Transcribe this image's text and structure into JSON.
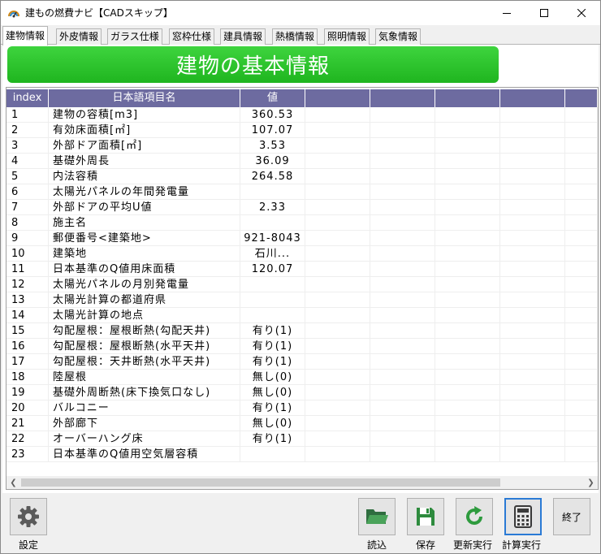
{
  "window": {
    "title": "建もの燃費ナビ【CADスキップ】"
  },
  "tabs": [
    {
      "label": "建物情報",
      "active": true
    },
    {
      "label": "外皮情報"
    },
    {
      "label": "ガラス仕様"
    },
    {
      "label": "窓枠仕様"
    },
    {
      "label": "建具情報"
    },
    {
      "label": "熱橋情報"
    },
    {
      "label": "照明情報"
    },
    {
      "label": "気象情報"
    }
  ],
  "header": {
    "title": "建物の基本情報",
    "color": "#2fc42f"
  },
  "grid": {
    "columns": [
      "index",
      "日本語項目名",
      "値",
      "",
      "",
      "",
      "",
      ""
    ],
    "header_color": "#6d6ba0",
    "rows": [
      {
        "index": "1",
        "name": "建物の容積[m3]",
        "value": "360.53"
      },
      {
        "index": "2",
        "name": "有効床面積[㎡]",
        "value": "107.07"
      },
      {
        "index": "3",
        "name": "外部ドア面積[㎡]",
        "value": "3.53"
      },
      {
        "index": "4",
        "name": "基礎外周長",
        "value": "36.09"
      },
      {
        "index": "5",
        "name": "内法容積",
        "value": "264.58"
      },
      {
        "index": "6",
        "name": "太陽光パネルの年間発電量",
        "value": ""
      },
      {
        "index": "7",
        "name": "外部ドアの平均U値",
        "value": "2.33"
      },
      {
        "index": "8",
        "name": "施主名",
        "value": ""
      },
      {
        "index": "9",
        "name": "郵便番号<建築地>",
        "value": "921-8043"
      },
      {
        "index": "10",
        "name": "建築地",
        "value": "石川..."
      },
      {
        "index": "11",
        "name": "日本基準のQ値用床面積",
        "value": "120.07"
      },
      {
        "index": "12",
        "name": "太陽光パネルの月別発電量",
        "value": ""
      },
      {
        "index": "13",
        "name": "太陽光計算の都道府県",
        "value": ""
      },
      {
        "index": "14",
        "name": "太陽光計算の地点",
        "value": ""
      },
      {
        "index": "15",
        "name": "勾配屋根：屋根断熱(勾配天井)",
        "value": "有り(1)"
      },
      {
        "index": "16",
        "name": "勾配屋根：屋根断熱(水平天井)",
        "value": "有り(1)"
      },
      {
        "index": "17",
        "name": "勾配屋根：天井断熱(水平天井)",
        "value": "有り(1)"
      },
      {
        "index": "18",
        "name": "陸屋根",
        "value": "無し(0)"
      },
      {
        "index": "19",
        "name": "基礎外周断熱(床下換気口なし)",
        "value": "無し(0)"
      },
      {
        "index": "20",
        "name": "バルコニー",
        "value": "有り(1)"
      },
      {
        "index": "21",
        "name": "外部廊下",
        "value": "無し(0)"
      },
      {
        "index": "22",
        "name": "オーバーハング床",
        "value": "有り(1)"
      },
      {
        "index": "23",
        "name": "日本基準のQ値用空気層容積",
        "value": ""
      }
    ]
  },
  "toolbar": {
    "settings": {
      "label": "設定",
      "icon": "gear-icon"
    },
    "load": {
      "label": "読込",
      "icon": "folder-open-icon"
    },
    "save": {
      "label": "保存",
      "icon": "floppy-disk-icon"
    },
    "refresh": {
      "label": "更新実行",
      "icon": "refresh-icon"
    },
    "calculate": {
      "label": "計算実行",
      "icon": "calculator-icon"
    },
    "exit": {
      "label": "終了"
    }
  }
}
